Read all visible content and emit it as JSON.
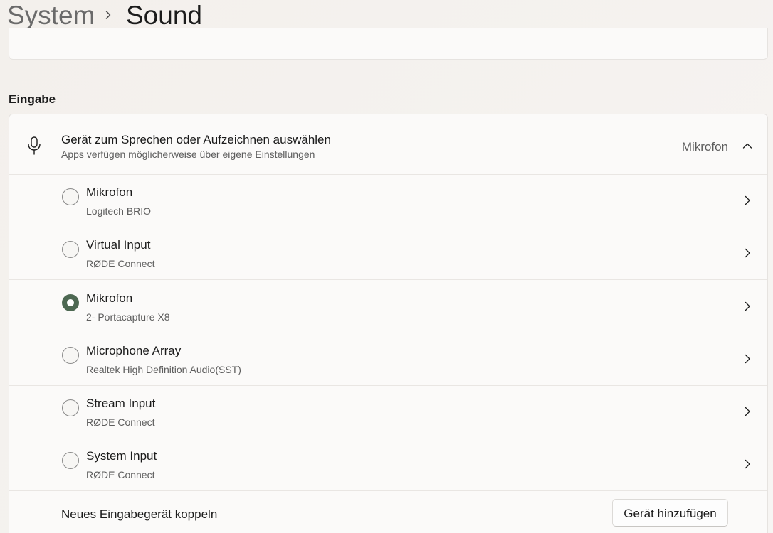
{
  "breadcrumb": {
    "parent": "System",
    "current": "Sound"
  },
  "section": {
    "title": "Eingabe"
  },
  "input_selector": {
    "icon": "microphone-icon",
    "title": "Gerät zum Sprechen oder Aufzeichnen auswählen",
    "subtitle": "Apps verfügen möglicherweise über eigene Einstellungen",
    "selected_value": "Mikrofon",
    "expanded": true
  },
  "devices": [
    {
      "name": "Mikrofon",
      "detail": "Logitech BRIO",
      "selected": false
    },
    {
      "name": "Virtual Input",
      "detail": "RØDE Connect",
      "selected": false
    },
    {
      "name": "Mikrofon",
      "detail": "2- Portacapture X8",
      "selected": true
    },
    {
      "name": "Microphone Array",
      "detail": "Realtek High Definition Audio(SST)",
      "selected": false
    },
    {
      "name": "Stream Input",
      "detail": "RØDE Connect",
      "selected": false
    },
    {
      "name": "System Input",
      "detail": "RØDE Connect",
      "selected": false
    }
  ],
  "pair": {
    "label": "Neues Eingabegerät koppeln",
    "button_label": "Gerät hinzufügen"
  },
  "colors": {
    "accent": "#4d6852",
    "background": "#f3f0ec",
    "card": "#fbfaf9"
  }
}
